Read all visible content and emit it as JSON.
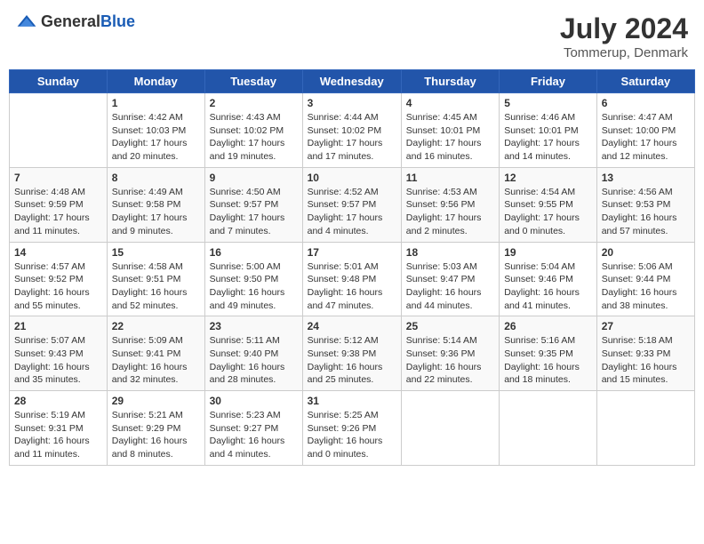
{
  "header": {
    "logo_general": "General",
    "logo_blue": "Blue",
    "title": "July 2024",
    "location": "Tommerup, Denmark"
  },
  "days": [
    "Sunday",
    "Monday",
    "Tuesday",
    "Wednesday",
    "Thursday",
    "Friday",
    "Saturday"
  ],
  "weeks": [
    [
      {
        "num": "",
        "text": ""
      },
      {
        "num": "1",
        "text": "Sunrise: 4:42 AM\nSunset: 10:03 PM\nDaylight: 17 hours\nand 20 minutes."
      },
      {
        "num": "2",
        "text": "Sunrise: 4:43 AM\nSunset: 10:02 PM\nDaylight: 17 hours\nand 19 minutes."
      },
      {
        "num": "3",
        "text": "Sunrise: 4:44 AM\nSunset: 10:02 PM\nDaylight: 17 hours\nand 17 minutes."
      },
      {
        "num": "4",
        "text": "Sunrise: 4:45 AM\nSunset: 10:01 PM\nDaylight: 17 hours\nand 16 minutes."
      },
      {
        "num": "5",
        "text": "Sunrise: 4:46 AM\nSunset: 10:01 PM\nDaylight: 17 hours\nand 14 minutes."
      },
      {
        "num": "6",
        "text": "Sunrise: 4:47 AM\nSunset: 10:00 PM\nDaylight: 17 hours\nand 12 minutes."
      }
    ],
    [
      {
        "num": "7",
        "text": "Sunrise: 4:48 AM\nSunset: 9:59 PM\nDaylight: 17 hours\nand 11 minutes."
      },
      {
        "num": "8",
        "text": "Sunrise: 4:49 AM\nSunset: 9:58 PM\nDaylight: 17 hours\nand 9 minutes."
      },
      {
        "num": "9",
        "text": "Sunrise: 4:50 AM\nSunset: 9:57 PM\nDaylight: 17 hours\nand 7 minutes."
      },
      {
        "num": "10",
        "text": "Sunrise: 4:52 AM\nSunset: 9:57 PM\nDaylight: 17 hours\nand 4 minutes."
      },
      {
        "num": "11",
        "text": "Sunrise: 4:53 AM\nSunset: 9:56 PM\nDaylight: 17 hours\nand 2 minutes."
      },
      {
        "num": "12",
        "text": "Sunrise: 4:54 AM\nSunset: 9:55 PM\nDaylight: 17 hours\nand 0 minutes."
      },
      {
        "num": "13",
        "text": "Sunrise: 4:56 AM\nSunset: 9:53 PM\nDaylight: 16 hours\nand 57 minutes."
      }
    ],
    [
      {
        "num": "14",
        "text": "Sunrise: 4:57 AM\nSunset: 9:52 PM\nDaylight: 16 hours\nand 55 minutes."
      },
      {
        "num": "15",
        "text": "Sunrise: 4:58 AM\nSunset: 9:51 PM\nDaylight: 16 hours\nand 52 minutes."
      },
      {
        "num": "16",
        "text": "Sunrise: 5:00 AM\nSunset: 9:50 PM\nDaylight: 16 hours\nand 49 minutes."
      },
      {
        "num": "17",
        "text": "Sunrise: 5:01 AM\nSunset: 9:48 PM\nDaylight: 16 hours\nand 47 minutes."
      },
      {
        "num": "18",
        "text": "Sunrise: 5:03 AM\nSunset: 9:47 PM\nDaylight: 16 hours\nand 44 minutes."
      },
      {
        "num": "19",
        "text": "Sunrise: 5:04 AM\nSunset: 9:46 PM\nDaylight: 16 hours\nand 41 minutes."
      },
      {
        "num": "20",
        "text": "Sunrise: 5:06 AM\nSunset: 9:44 PM\nDaylight: 16 hours\nand 38 minutes."
      }
    ],
    [
      {
        "num": "21",
        "text": "Sunrise: 5:07 AM\nSunset: 9:43 PM\nDaylight: 16 hours\nand 35 minutes."
      },
      {
        "num": "22",
        "text": "Sunrise: 5:09 AM\nSunset: 9:41 PM\nDaylight: 16 hours\nand 32 minutes."
      },
      {
        "num": "23",
        "text": "Sunrise: 5:11 AM\nSunset: 9:40 PM\nDaylight: 16 hours\nand 28 minutes."
      },
      {
        "num": "24",
        "text": "Sunrise: 5:12 AM\nSunset: 9:38 PM\nDaylight: 16 hours\nand 25 minutes."
      },
      {
        "num": "25",
        "text": "Sunrise: 5:14 AM\nSunset: 9:36 PM\nDaylight: 16 hours\nand 22 minutes."
      },
      {
        "num": "26",
        "text": "Sunrise: 5:16 AM\nSunset: 9:35 PM\nDaylight: 16 hours\nand 18 minutes."
      },
      {
        "num": "27",
        "text": "Sunrise: 5:18 AM\nSunset: 9:33 PM\nDaylight: 16 hours\nand 15 minutes."
      }
    ],
    [
      {
        "num": "28",
        "text": "Sunrise: 5:19 AM\nSunset: 9:31 PM\nDaylight: 16 hours\nand 11 minutes."
      },
      {
        "num": "29",
        "text": "Sunrise: 5:21 AM\nSunset: 9:29 PM\nDaylight: 16 hours\nand 8 minutes."
      },
      {
        "num": "30",
        "text": "Sunrise: 5:23 AM\nSunset: 9:27 PM\nDaylight: 16 hours\nand 4 minutes."
      },
      {
        "num": "31",
        "text": "Sunrise: 5:25 AM\nSunset: 9:26 PM\nDaylight: 16 hours\nand 0 minutes."
      },
      {
        "num": "",
        "text": ""
      },
      {
        "num": "",
        "text": ""
      },
      {
        "num": "",
        "text": ""
      }
    ]
  ]
}
